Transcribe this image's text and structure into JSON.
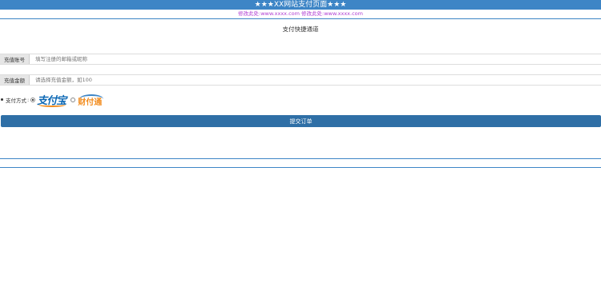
{
  "header": {
    "title": "★★★XX网站支付页面★★★",
    "notice": "修改此处:www.xxxx.com 修改此处:www.xxxx.com"
  },
  "main": {
    "section_title": "支付快捷通道",
    "account_field": {
      "label": "充值账号",
      "placeholder": "填写注册的邮箱或昵称",
      "value": ""
    },
    "amount_field": {
      "label": "充值金额",
      "placeholder": "请选择充值金额，如100",
      "value": ""
    },
    "payment": {
      "label": "支付方式",
      "options": [
        {
          "name": "支付宝",
          "selected": true,
          "logo_color": "#0b67b4"
        },
        {
          "name": "财付通",
          "selected": false,
          "logo_color": "#f28c1e"
        }
      ]
    },
    "submit_label": "提交订单"
  },
  "colors": {
    "accent": "#3d85c6",
    "notice": "#b03bd1",
    "button": "#2f6fa6"
  }
}
